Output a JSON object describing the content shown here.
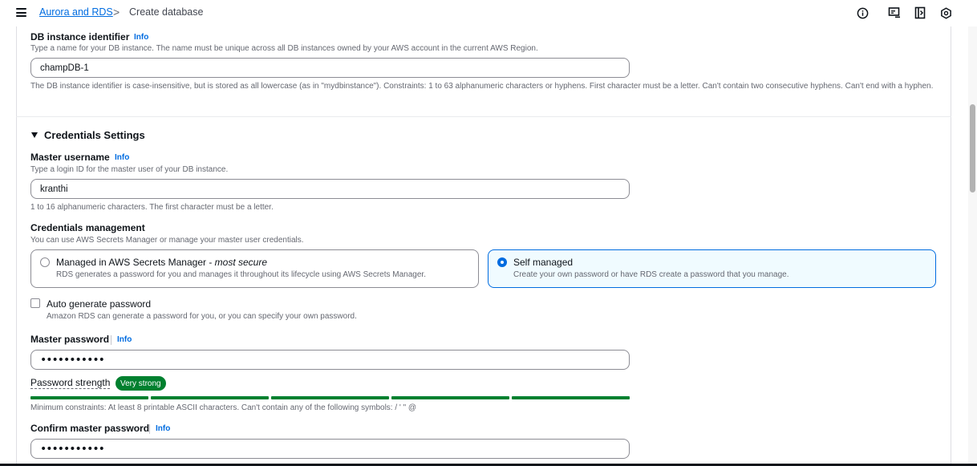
{
  "breadcrumb": {
    "link": "Aurora and RDS",
    "separator": ">",
    "current": "Create database"
  },
  "top_icons": [
    "info-circle-icon",
    "feedback-icon",
    "side-panel-icon",
    "notifications-icon"
  ],
  "db_instance": {
    "label": "DB instance identifier",
    "info": "Info",
    "description": "Type a name for your DB instance. The name must be unique across all DB instances owned by your AWS account in the current AWS Region.",
    "value": "champDB-1",
    "constraint": "The DB instance identifier is case-insensitive, but is stored as all lowercase (as in \"mydbinstance\"). Constraints: 1 to 63 alphanumeric characters or hyphens. First character must be a letter. Can't contain two consecutive hyphens. Can't end with a hyphen."
  },
  "credentials": {
    "section_title": "Credentials Settings",
    "master_username": {
      "label": "Master username",
      "info": "Info",
      "description": "Type a login ID for the master user of your DB instance.",
      "value": "kranthi",
      "constraint": "1 to 16 alphanumeric characters. The first character must be a letter."
    },
    "management": {
      "label": "Credentials management",
      "description": "You can use AWS Secrets Manager or manage your master user credentials.",
      "options": [
        {
          "title": "Managed in AWS Secrets Manager - ",
          "title_em": "most secure",
          "description": "RDS generates a password for you and manages it throughout its lifecycle using AWS Secrets Manager.",
          "selected": false
        },
        {
          "title": "Self managed",
          "title_em": "",
          "description": "Create your own password or have RDS create a password that you manage.",
          "selected": true
        }
      ]
    },
    "auto_generate": {
      "label": "Auto generate password",
      "description": "Amazon RDS can generate a password for you, or you can specify your own password.",
      "checked": false
    },
    "master_password": {
      "label": "Master password",
      "info": "Info",
      "value": "•••••••••••"
    },
    "password_strength": {
      "label": "Password strength",
      "badge": "Very strong",
      "level": 1.0,
      "color": "#00802f",
      "constraint": "Minimum constraints: At least 8 printable ASCII characters. Can't contain any of the following symbols: / ' \" @"
    },
    "confirm_password": {
      "label": "Confirm master password",
      "info": "Info",
      "value": "•••••••••••"
    }
  },
  "colors": {
    "accent": "#006ce0",
    "success": "#00802f",
    "text": "#0f141a",
    "secondary_text": "#656871"
  }
}
